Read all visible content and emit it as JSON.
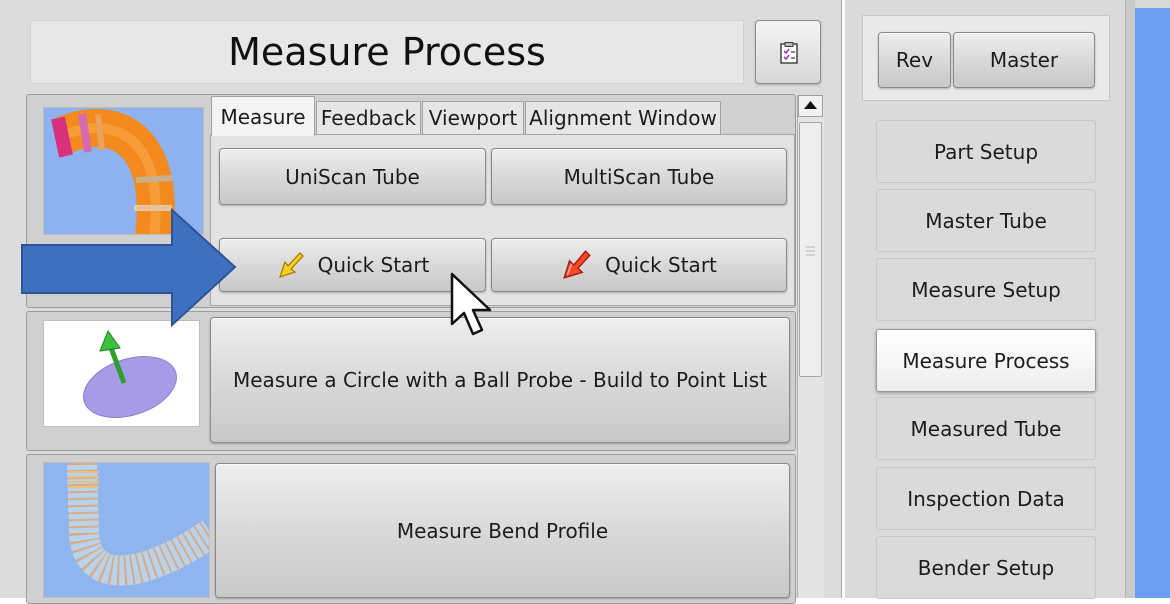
{
  "header": {
    "title": "Measure Process",
    "checklist_icon": "checklist-icon"
  },
  "tabs": [
    {
      "label": "Measure",
      "active": true
    },
    {
      "label": "Feedback",
      "active": false
    },
    {
      "label": "Viewport",
      "active": false
    },
    {
      "label": "Alignment Window",
      "active": false
    }
  ],
  "tube_scan": {
    "uniscan_label": "UniScan Tube",
    "multiscan_label": "MultiScan Tube",
    "quick_start_left": "Quick Start",
    "quick_start_right": "Quick Start",
    "quick_start_left_icon": "yellow-arrow-icon",
    "quick_start_right_icon": "red-arrow-icon"
  },
  "procedures": {
    "circle_label": "Measure a Circle with a Ball Probe - Build to Point List",
    "bend_profile_label": "Measure Bend Profile"
  },
  "right_panel": {
    "rev_label": "Rev",
    "master_label": "Master",
    "nav_items": [
      {
        "label": "Part Setup",
        "selected": false
      },
      {
        "label": "Master Tube",
        "selected": false
      },
      {
        "label": "Measure Setup",
        "selected": false
      },
      {
        "label": "Measure Process",
        "selected": true
      },
      {
        "label": "Measured Tube",
        "selected": false
      },
      {
        "label": "Inspection Data",
        "selected": false
      },
      {
        "label": "Bender Setup",
        "selected": false
      }
    ]
  },
  "colors": {
    "overlay_arrow": "#3f6fbf",
    "accent_blue": "#6f9ff2",
    "tube_orange": "#f28a1e"
  }
}
